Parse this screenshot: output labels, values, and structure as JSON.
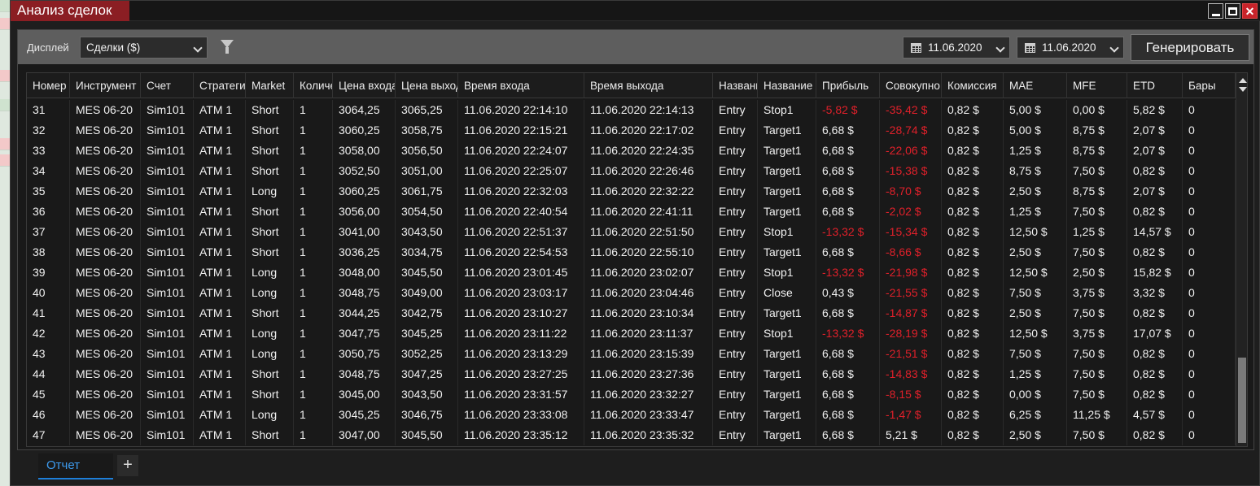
{
  "window": {
    "title": "Анализ сделок"
  },
  "toolbar": {
    "display_label": "Дисплей",
    "display_value": "Сделки ($)",
    "date_from": "11.06.2020",
    "date_to": "11.06.2020",
    "generate_label": "Генерировать"
  },
  "columns": [
    "Номер",
    "Инструмент",
    "Счет",
    "Стратегия",
    "Market",
    "Количество",
    "Цена входа",
    "Цена выхода",
    "Время входа",
    "Время выхода",
    "Название входа",
    "Название выхода",
    "Прибыль",
    "Совокупно",
    "Комиссия",
    "MAE",
    "MFE",
    "ETD",
    "Бары"
  ],
  "rows": [
    [
      "31",
      "MES 06-20",
      "Sim101",
      "ATM 1",
      "Short",
      "1",
      "3064,25",
      "3065,25",
      "11.06.2020 22:14:10",
      "11.06.2020 22:14:13",
      "Entry",
      "Stop1",
      "-5,82 $",
      "-35,42 $",
      "0,82 $",
      "5,00 $",
      "0,00 $",
      "5,82 $",
      "0"
    ],
    [
      "32",
      "MES 06-20",
      "Sim101",
      "ATM 1",
      "Short",
      "1",
      "3060,25",
      "3058,75",
      "11.06.2020 22:15:21",
      "11.06.2020 22:17:02",
      "Entry",
      "Target1",
      "6,68 $",
      "-28,74 $",
      "0,82 $",
      "5,00 $",
      "8,75 $",
      "2,07 $",
      "0"
    ],
    [
      "33",
      "MES 06-20",
      "Sim101",
      "ATM 1",
      "Short",
      "1",
      "3058,00",
      "3056,50",
      "11.06.2020 22:24:07",
      "11.06.2020 22:24:35",
      "Entry",
      "Target1",
      "6,68 $",
      "-22,06 $",
      "0,82 $",
      "1,25 $",
      "8,75 $",
      "2,07 $",
      "0"
    ],
    [
      "34",
      "MES 06-20",
      "Sim101",
      "ATM 1",
      "Short",
      "1",
      "3052,50",
      "3051,00",
      "11.06.2020 22:25:07",
      "11.06.2020 22:26:46",
      "Entry",
      "Target1",
      "6,68 $",
      "-15,38 $",
      "0,82 $",
      "8,75 $",
      "7,50 $",
      "0,82 $",
      "0"
    ],
    [
      "35",
      "MES 06-20",
      "Sim101",
      "ATM 1",
      "Long",
      "1",
      "3060,25",
      "3061,75",
      "11.06.2020 22:32:03",
      "11.06.2020 22:32:22",
      "Entry",
      "Target1",
      "6,68 $",
      "-8,70 $",
      "0,82 $",
      "2,50 $",
      "8,75 $",
      "2,07 $",
      "0"
    ],
    [
      "36",
      "MES 06-20",
      "Sim101",
      "ATM 1",
      "Short",
      "1",
      "3056,00",
      "3054,50",
      "11.06.2020 22:40:54",
      "11.06.2020 22:41:11",
      "Entry",
      "Target1",
      "6,68 $",
      "-2,02 $",
      "0,82 $",
      "1,25 $",
      "7,50 $",
      "0,82 $",
      "0"
    ],
    [
      "37",
      "MES 06-20",
      "Sim101",
      "ATM 1",
      "Short",
      "1",
      "3041,00",
      "3043,50",
      "11.06.2020 22:51:37",
      "11.06.2020 22:51:50",
      "Entry",
      "Stop1",
      "-13,32 $",
      "-15,34 $",
      "0,82 $",
      "12,50 $",
      "1,25 $",
      "14,57 $",
      "0"
    ],
    [
      "38",
      "MES 06-20",
      "Sim101",
      "ATM 1",
      "Short",
      "1",
      "3036,25",
      "3034,75",
      "11.06.2020 22:54:53",
      "11.06.2020 22:55:10",
      "Entry",
      "Target1",
      "6,68 $",
      "-8,66 $",
      "0,82 $",
      "2,50 $",
      "7,50 $",
      "0,82 $",
      "0"
    ],
    [
      "39",
      "MES 06-20",
      "Sim101",
      "ATM 1",
      "Long",
      "1",
      "3048,00",
      "3045,50",
      "11.06.2020 23:01:45",
      "11.06.2020 23:02:07",
      "Entry",
      "Stop1",
      "-13,32 $",
      "-21,98 $",
      "0,82 $",
      "12,50 $",
      "2,50 $",
      "15,82 $",
      "0"
    ],
    [
      "40",
      "MES 06-20",
      "Sim101",
      "ATM 1",
      "Long",
      "1",
      "3048,75",
      "3049,00",
      "11.06.2020 23:03:17",
      "11.06.2020 23:04:46",
      "Entry",
      "Close",
      "0,43 $",
      "-21,55 $",
      "0,82 $",
      "7,50 $",
      "3,75 $",
      "3,32 $",
      "0"
    ],
    [
      "41",
      "MES 06-20",
      "Sim101",
      "ATM 1",
      "Short",
      "1",
      "3044,25",
      "3042,75",
      "11.06.2020 23:10:27",
      "11.06.2020 23:10:34",
      "Entry",
      "Target1",
      "6,68 $",
      "-14,87 $",
      "0,82 $",
      "2,50 $",
      "7,50 $",
      "0,82 $",
      "0"
    ],
    [
      "42",
      "MES 06-20",
      "Sim101",
      "ATM 1",
      "Long",
      "1",
      "3047,75",
      "3045,25",
      "11.06.2020 23:11:22",
      "11.06.2020 23:11:37",
      "Entry",
      "Stop1",
      "-13,32 $",
      "-28,19 $",
      "0,82 $",
      "12,50 $",
      "3,75 $",
      "17,07 $",
      "0"
    ],
    [
      "43",
      "MES 06-20",
      "Sim101",
      "ATM 1",
      "Long",
      "1",
      "3050,75",
      "3052,25",
      "11.06.2020 23:13:29",
      "11.06.2020 23:15:39",
      "Entry",
      "Target1",
      "6,68 $",
      "-21,51 $",
      "0,82 $",
      "7,50 $",
      "7,50 $",
      "0,82 $",
      "0"
    ],
    [
      "44",
      "MES 06-20",
      "Sim101",
      "ATM 1",
      "Short",
      "1",
      "3048,75",
      "3047,25",
      "11.06.2020 23:27:25",
      "11.06.2020 23:27:36",
      "Entry",
      "Target1",
      "6,68 $",
      "-14,83 $",
      "0,82 $",
      "1,25 $",
      "7,50 $",
      "0,82 $",
      "0"
    ],
    [
      "45",
      "MES 06-20",
      "Sim101",
      "ATM 1",
      "Short",
      "1",
      "3045,00",
      "3043,50",
      "11.06.2020 23:31:57",
      "11.06.2020 23:32:27",
      "Entry",
      "Target1",
      "6,68 $",
      "-8,15 $",
      "0,82 $",
      "0,00 $",
      "7,50 $",
      "0,82 $",
      "0"
    ],
    [
      "46",
      "MES 06-20",
      "Sim101",
      "ATM 1",
      "Long",
      "1",
      "3045,25",
      "3046,75",
      "11.06.2020 23:33:08",
      "11.06.2020 23:33:47",
      "Entry",
      "Target1",
      "6,68 $",
      "-1,47 $",
      "0,82 $",
      "6,25 $",
      "11,25 $",
      "4,57 $",
      "0"
    ],
    [
      "47",
      "MES 06-20",
      "Sim101",
      "ATM 1",
      "Short",
      "1",
      "3047,00",
      "3045,50",
      "11.06.2020 23:35:12",
      "11.06.2020 23:35:32",
      "Entry",
      "Target1",
      "6,68 $",
      "5,21 $",
      "0,82 $",
      "2,50 $",
      "7,50 $",
      "0,82 $",
      "0"
    ]
  ],
  "tabs": {
    "active": "Отчет",
    "add": "+"
  },
  "colors": {
    "title_bg": "#8b1e23",
    "negative": "#e0202a",
    "active_tab": "#3d9bef"
  }
}
